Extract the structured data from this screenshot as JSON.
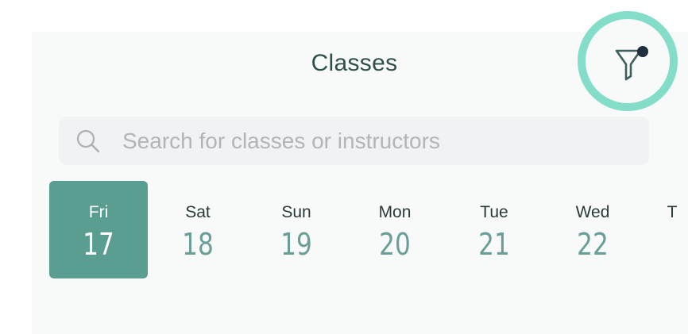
{
  "header": {
    "title": "Classes"
  },
  "filter": {
    "icon": "filter-funnel-icon",
    "active_dot": true,
    "highlight_color": "#84ddc9"
  },
  "search": {
    "placeholder": "Search for classes or instructors",
    "value": ""
  },
  "days": [
    {
      "dow": "Fri",
      "num": "17",
      "selected": true
    },
    {
      "dow": "Sat",
      "num": "18",
      "selected": false
    },
    {
      "dow": "Sun",
      "num": "19",
      "selected": false
    },
    {
      "dow": "Mon",
      "num": "20",
      "selected": false
    },
    {
      "dow": "Tue",
      "num": "21",
      "selected": false
    },
    {
      "dow": "Wed",
      "num": "22",
      "selected": false
    },
    {
      "dow": "T",
      "num": "",
      "selected": false
    }
  ],
  "colors": {
    "accent": "#5a9e91",
    "date_number": "#6a9e96",
    "title": "#2f4f4c"
  }
}
